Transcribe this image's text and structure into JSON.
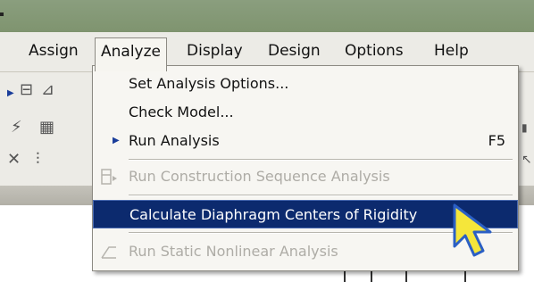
{
  "menubar": {
    "items": [
      "Assign",
      "Analyze",
      "Display",
      "Design",
      "Options",
      "Help"
    ]
  },
  "analyze_menu": {
    "items": [
      {
        "label": "Set Analysis Options...",
        "enabled": true
      },
      {
        "label": "Check Model...",
        "enabled": true
      },
      {
        "label": "Run Analysis",
        "enabled": true,
        "shortcut": "F5"
      },
      {
        "label": "Run Construction Sequence Analysis",
        "enabled": false
      },
      {
        "label": "Calculate Diaphragm Centers of Rigidity",
        "enabled": true,
        "highlighted": true
      },
      {
        "label": "Run Static Nonlinear Analysis",
        "enabled": false
      }
    ]
  },
  "colors": {
    "highlight": "#0c2a6e",
    "cursor": "#f5e63a"
  },
  "icons": [
    "arrow-icon",
    "cursor-arrow-icon"
  ]
}
